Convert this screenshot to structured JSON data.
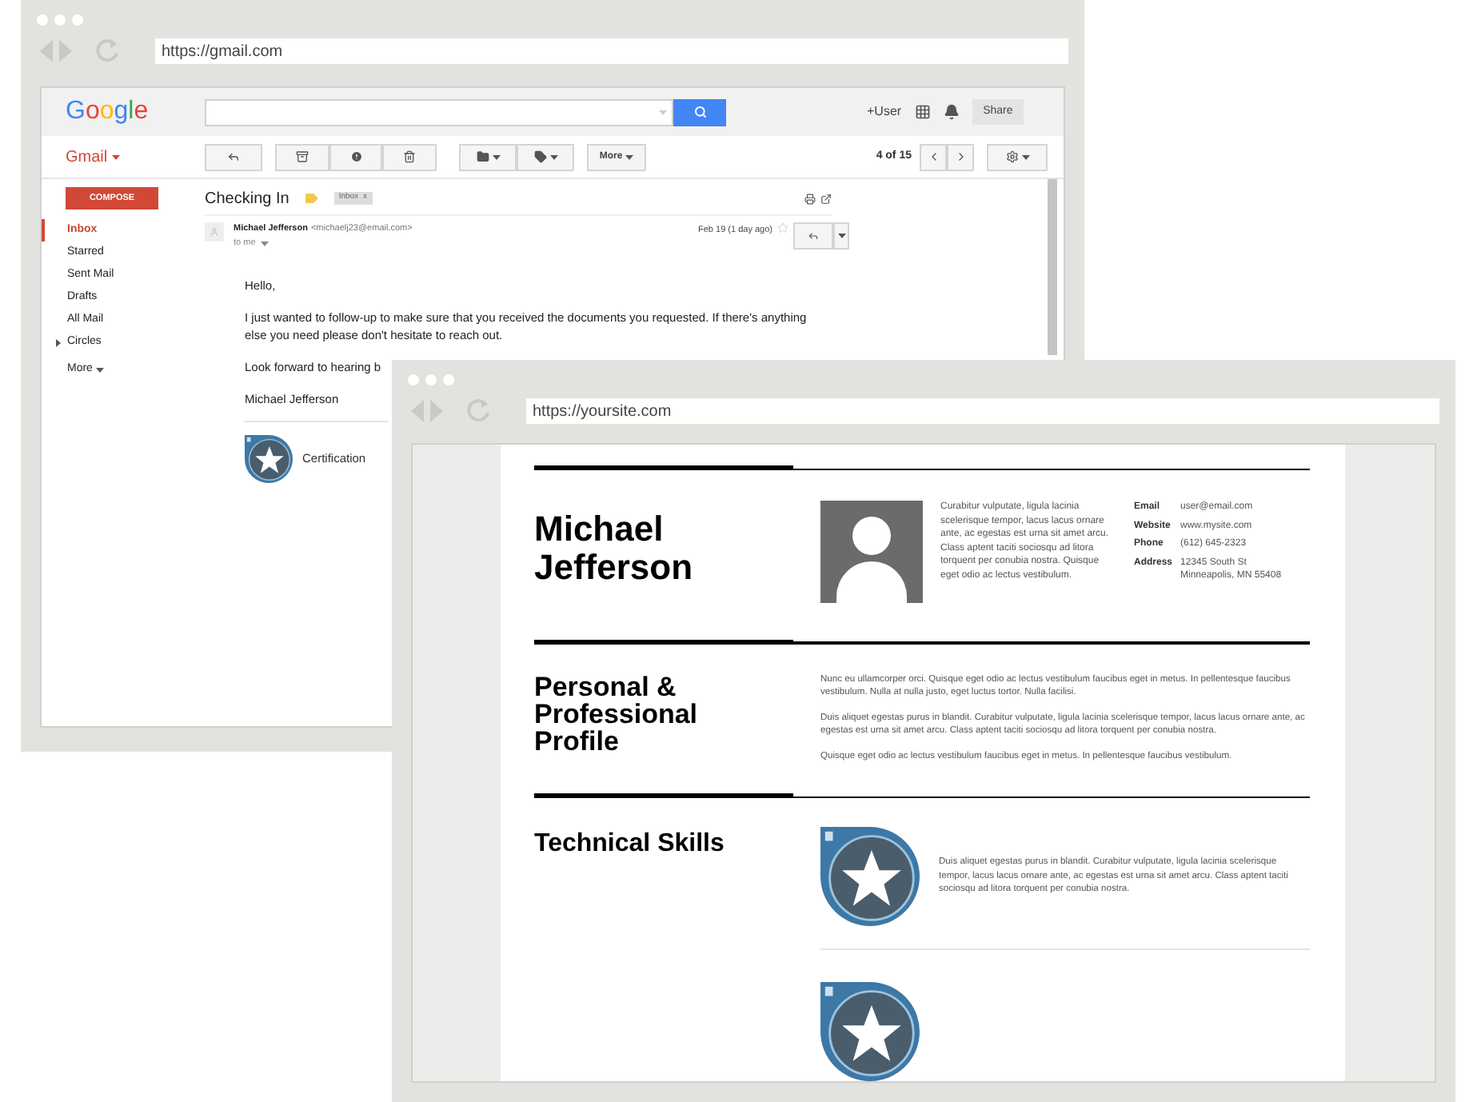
{
  "gmail_window": {
    "url": "https://gmail.com",
    "logo": "Google",
    "header": {
      "user_label": "+User",
      "share_button": "Share"
    },
    "toolbar": {
      "app_menu": "Gmail",
      "more_button": "More",
      "pagination": "4 of 15"
    },
    "sidebar": {
      "compose_button": "COMPOSE",
      "items": [
        {
          "label": "Inbox",
          "selected": true,
          "expandable": false
        },
        {
          "label": "Starred",
          "selected": false,
          "expandable": false
        },
        {
          "label": "Sent Mail",
          "selected": false,
          "expandable": false
        },
        {
          "label": "Drafts",
          "selected": false,
          "expandable": false
        },
        {
          "label": "All Mail",
          "selected": false,
          "expandable": false
        },
        {
          "label": "Circles",
          "selected": false,
          "expandable": true
        }
      ],
      "more": "More"
    },
    "message": {
      "subject": "Checking In",
      "label_chip": "Inbox",
      "label_chip_close": "x",
      "sender_name": "Michael Jefferson",
      "sender_email": "<michaelj23@email.com>",
      "recipient": "to me",
      "date": "Feb 19 (1 day ago)",
      "body": [
        "Hello,",
        "I just wanted to follow-up to make sure that you received the documents you requested. If there's anything else you need please don't hesitate to reach out.",
        "Look forward to hearing b"
      ],
      "signature": "Michael Jefferson",
      "attachment_label": "Certification"
    }
  },
  "resume_window": {
    "url": "https://yoursite.com",
    "name": "Michael Jefferson",
    "intro": "Curabitur vulputate, ligula lacinia scelerisque tempor, lacus lacus ornare ante, ac egestas est urna sit amet arcu. Class aptent taciti sociosqu ad litora torquent per conubia nostra. Quisque eget odio ac lectus vestibulum.",
    "contacts": [
      {
        "label": "Email",
        "value": "user@email.com"
      },
      {
        "label": "Website",
        "value": "www.mysite.com"
      },
      {
        "label": "Phone",
        "value": "(612) 645-2323"
      },
      {
        "label": "Address",
        "value": "12345 South St\nMinneapolis, MN 55408"
      }
    ],
    "sections": [
      {
        "kind": "text",
        "title": "Personal & Professional Profile",
        "paragraphs": [
          "Nunc eu ullamcorper orci. Quisque eget odio ac lectus vestibulum faucibus eget in metus. In pellentesque faucibus vestibulum. Nulla at nulla justo, eget luctus tortor. Nulla facilisi.",
          "Duis aliquet egestas purus in blandit. Curabitur vulputate, ligula lacinia scelerisque tempor, lacus lacus ornare ante, ac egestas est urna sit amet arcu. Class aptent taciti sociosqu ad litora torquent per conubia nostra.",
          "Quisque eget odio ac lectus vestibulum faucibus eget in metus. In pellentesque faucibus vestibulum."
        ]
      },
      {
        "kind": "skills",
        "title": "Technical Skills",
        "items": [
          {
            "badge": true,
            "description": "Duis aliquet egestas purus in blandit. Curabitur vulputate, ligula lacinia scelerisque tempor, lacus lacus ornare ante, ac egestas est urna sit amet arcu. Class aptent taciti sociosqu ad litora torquent per conubia nostra."
          },
          {
            "badge": true
          }
        ]
      }
    ]
  }
}
